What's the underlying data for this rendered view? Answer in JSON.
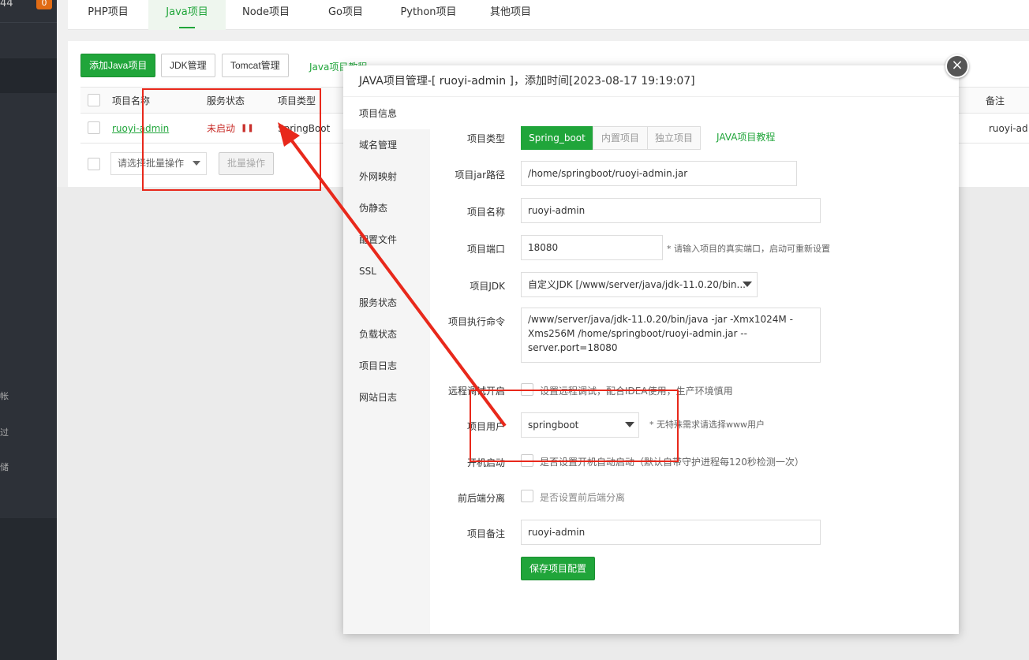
{
  "sidebar": {
    "num": "44",
    "badge": "0",
    "fragments": [
      "帐",
      "过",
      "储"
    ]
  },
  "tabs": [
    "PHP项目",
    "Java项目",
    "Node项目",
    "Go项目",
    "Python项目",
    "其他项目"
  ],
  "toolbar": {
    "add": "添加Java项目",
    "jdk": "JDK管理",
    "tomcat": "Tomcat管理",
    "tutorial": "Java项目教程"
  },
  "table": {
    "headers": {
      "name": "项目名称",
      "status": "服务状态",
      "type": "项目类型",
      "remark": "备注"
    },
    "row": {
      "name": "ruoyi-admin",
      "status": "未启动",
      "type": "SpringBoot",
      "remark": "ruoyi-ad"
    }
  },
  "batch": {
    "select": "请选择批量操作",
    "button": "批量操作"
  },
  "modal": {
    "title": "JAVA项目管理-[ ruoyi-admin ]，添加时间[2023-08-17 19:19:07]",
    "nav": [
      "项目信息",
      "域名管理",
      "外网映射",
      "伪静态",
      "配置文件",
      "SSL",
      "服务状态",
      "负载状态",
      "项目日志",
      "网站日志"
    ],
    "form": {
      "type_label": "项目类型",
      "type_options": [
        "Spring_boot",
        "内置项目",
        "独立项目"
      ],
      "tutorial": "JAVA项目教程",
      "jar_label": "项目jar路径",
      "jar_value": "/home/springboot/ruoyi-admin.jar",
      "name_label": "项目名称",
      "name_value": "ruoyi-admin",
      "port_label": "项目端口",
      "port_value": "18080",
      "port_hint": "* 请输入项目的真实端口，启动可重新设置",
      "jdk_label": "项目JDK",
      "jdk_value": "自定义JDK [/www/server/java/jdk-11.0.20/bin...",
      "cmd_label": "项目执行命令",
      "cmd_value": "/www/server/java/jdk-11.0.20/bin/java -jar -Xmx1024M -Xms256M  /home/springboot/ruoyi-admin.jar --server.port=18080",
      "debug_label": "远程调试开启",
      "debug_hint": "设置远程调试，配合IDEA使用，生产环境慎用",
      "user_label": "项目用户",
      "user_value": "springboot",
      "user_hint": "* 无特殊需求请选择www用户",
      "boot_label": "开机启动",
      "boot_hint": "是否设置开机自动启动（默认自带守护进程每120秒检测一次）",
      "split_label": "前后端分离",
      "split_hint": "是否设置前后端分离",
      "remark_label": "项目备注",
      "remark_value": "ruoyi-admin",
      "save": "保存项目配置"
    }
  },
  "colors": {
    "accent": "#20a53a",
    "sidebar": "#2d3138",
    "annotation": "#e8281b",
    "status_stopped": "#c9302c"
  }
}
